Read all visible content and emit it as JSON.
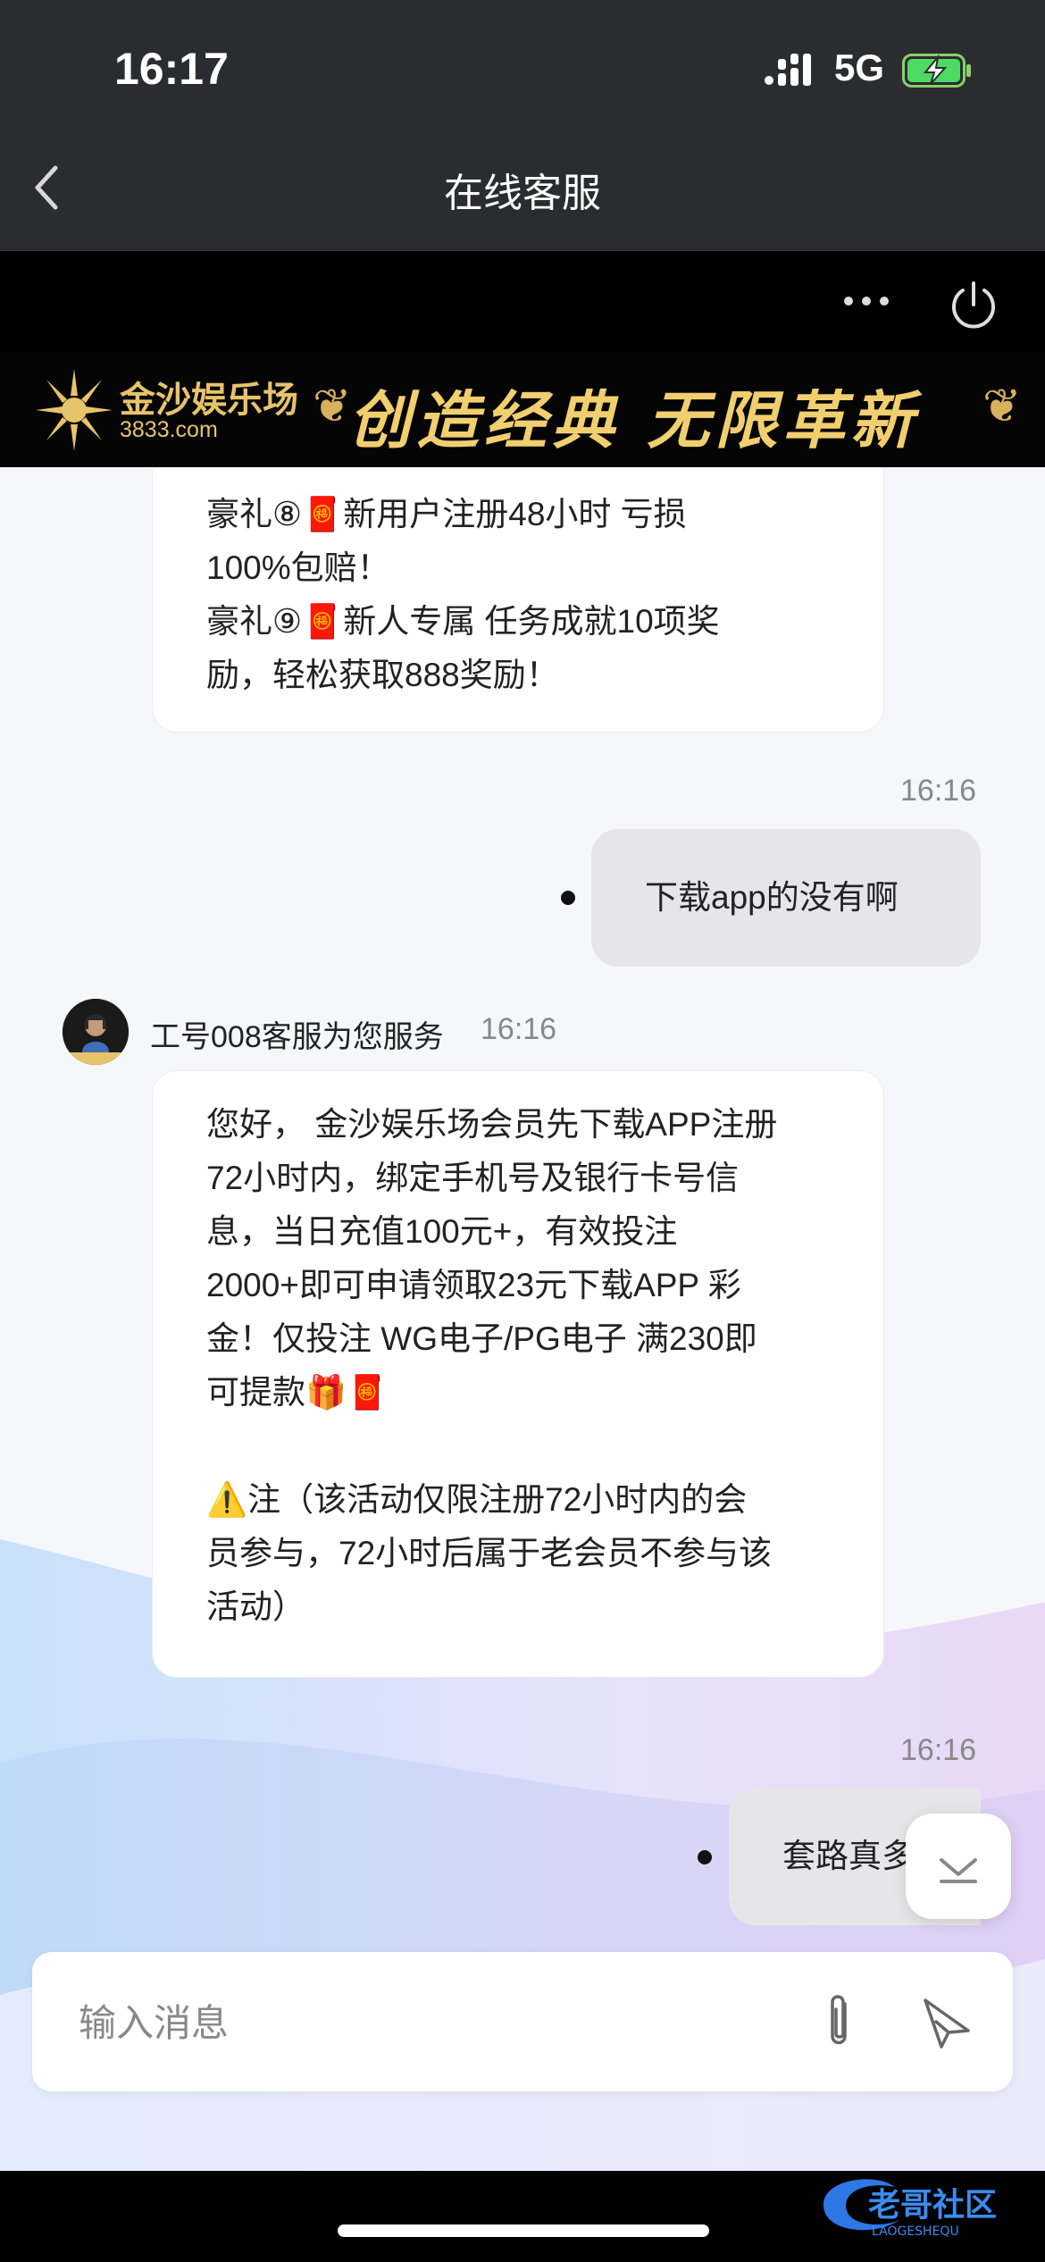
{
  "status_bar": {
    "time": "16:17",
    "network": "5G"
  },
  "nav": {
    "title": "在线客服"
  },
  "banner": {
    "brand_name": "金沙娱乐场",
    "brand_url": "3833.com",
    "slogan": "创造经典 无限革新"
  },
  "messages": {
    "m1_lines": [
      "豪礼⑧🧧新用户注册48小时 亏损",
      "100%包赔！",
      "豪礼⑨🧧新人专属 任务成就10项奖",
      "励，轻松获取888奖励！"
    ],
    "m2_time": "16:16",
    "m2_text": "下载app的没有啊",
    "agent_name": "工号008客服为您服务",
    "agent_time": "16:16",
    "m3_lines": [
      "您好， 金沙娱乐场会员先下载APP注册",
      "72小时内，绑定手机号及银行卡号信",
      "息，当日充值100元+，有效投注",
      "2000+即可申请领取23元下载APP 彩",
      "金！仅投注 WG电子/PG电子 满230即",
      "可提款🎁🧧",
      "",
      "⚠️注（该活动仅限注册72小时内的会",
      "员参与，72小时后属于老会员不参与该",
      "活动）"
    ],
    "m4_time": "16:16",
    "m4_text": "套路真多"
  },
  "input": {
    "placeholder": "输入消息"
  },
  "watermark": {
    "text": "老哥社区",
    "sub": "LAOGESHEQU"
  },
  "icons": [
    "back-chevron-icon",
    "more-dots-icon",
    "power-icon",
    "attach-paperclip-icon",
    "send-icon",
    "chevron-down-icon"
  ]
}
